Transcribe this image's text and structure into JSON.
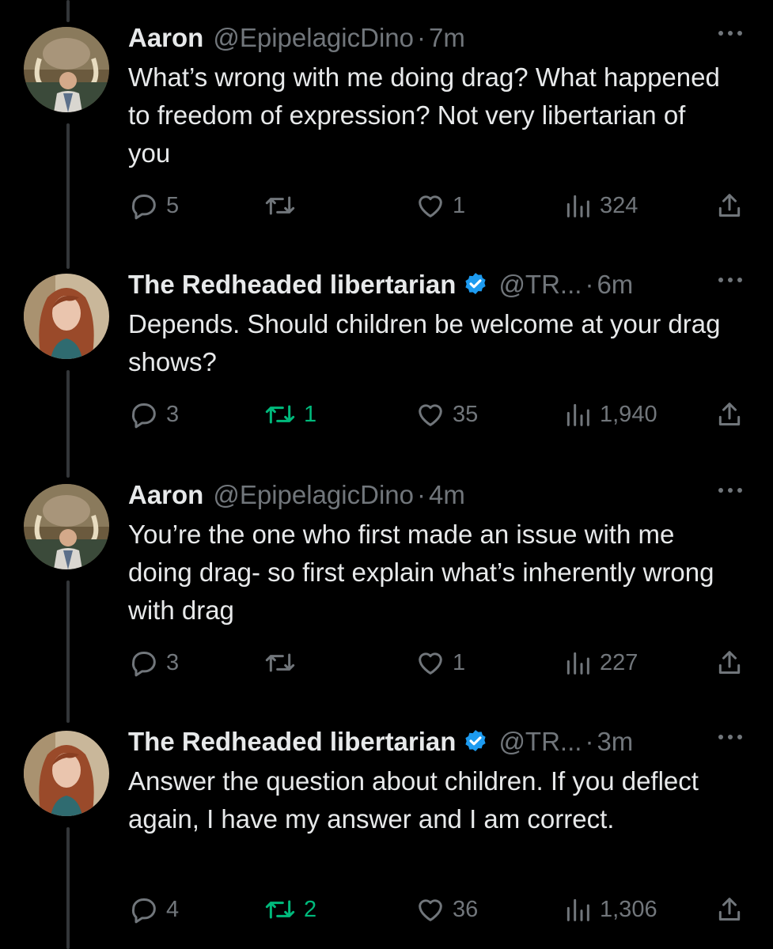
{
  "tweets": [
    {
      "name": "Aaron",
      "verified": false,
      "handle": "@EpipelagicDino",
      "dot": "·",
      "time": "7m",
      "text": "What’s wrong with me doing drag? What happened to freedom of expression? Not very libertarian of you",
      "replies": "5",
      "retweets": "",
      "retweeted": false,
      "likes": "1",
      "views": "324",
      "avatar": "aaron"
    },
    {
      "name": "The Redheaded libertarian",
      "verified": true,
      "handle": "@TR...",
      "dot": "·",
      "time": "6m",
      "text": "Depends. Should children be welcome at your drag shows?",
      "replies": "3",
      "retweets": "1",
      "retweeted": true,
      "likes": "35",
      "views": "1,940",
      "avatar": "redhead"
    },
    {
      "name": "Aaron",
      "verified": false,
      "handle": "@EpipelagicDino",
      "dot": "·",
      "time": "4m",
      "text": "You’re the one who first made an issue with me doing drag- so first explain what’s inherently wrong with drag",
      "replies": "3",
      "retweets": "",
      "retweeted": false,
      "likes": "1",
      "views": "227",
      "avatar": "aaron"
    },
    {
      "name": "The Redheaded libertarian",
      "verified": true,
      "handle": "@TR...",
      "dot": "·",
      "time": "3m",
      "text": "Answer the question about children. If you deflect again, I have my answer and I am correct.",
      "replies": "4",
      "retweets": "2",
      "retweeted": true,
      "likes": "36",
      "views": "1,306",
      "avatar": "redhead"
    }
  ],
  "colors": {
    "background": "#000000",
    "primary_text": "#e7e9ea",
    "secondary_text": "#71767b",
    "verified_badge": "#1d9bf0",
    "retweet_active": "#00ba7c",
    "thread_line": "#333639"
  },
  "icons": {
    "reply": "reply-icon",
    "retweet": "retweet-icon",
    "like": "heart-icon",
    "views": "views-chart-icon",
    "share": "share-icon",
    "more": "more-icon",
    "verified": "verified-badge-icon"
  }
}
